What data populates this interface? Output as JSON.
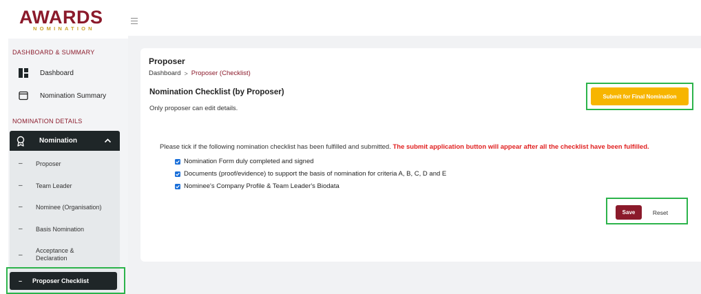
{
  "brand": {
    "logo_main": "AWARDS",
    "logo_sub": "NOMINATION"
  },
  "sidebar": {
    "section_dashboard": "DASHBOARD & SUMMARY",
    "dashboard": "Dashboard",
    "nomination_summary": "Nomination Summary",
    "section_details": "NOMINATION DETAILS",
    "group_label": "Nomination",
    "sub_items": [
      "Proposer",
      "Team Leader",
      "Nominee (Organisation)",
      "Basis Nomination",
      "Acceptance &",
      "Declaration"
    ],
    "active_item": "Proposer Checklist"
  },
  "page": {
    "title": "Proposer",
    "breadcrumb_root": "Dashboard",
    "breadcrumb_sep": ">",
    "breadcrumb_current": "Proposer (Checklist)",
    "checklist_title": "Nomination Checklist (by Proposer)",
    "edit_note": "Only proposer can edit details.",
    "submit_label": "Submit for Final Nomination",
    "instruction": "Please tick if the following nomination checklist has been fulfilled and submitted. ",
    "instruction_warning": "The submit application button will appear after all the checklist have been fulfilled.",
    "checklist": [
      "Nomination Form duly completed and signed",
      "Documents (proof/evidence) to support the basis of nomination for criteria A, B, C, D and E",
      "Nominee's Company Profile & Team Leader's Biodata"
    ],
    "save_label": "Save",
    "reset_label": "Reset"
  },
  "colors": {
    "brand": "#8b1a2b",
    "accent_gold": "#f7b500",
    "highlight_green": "#2bb34a",
    "dark_nav": "#1f2628",
    "checkbox_blue": "#1a6fd9",
    "warning_red": "#e02020"
  }
}
